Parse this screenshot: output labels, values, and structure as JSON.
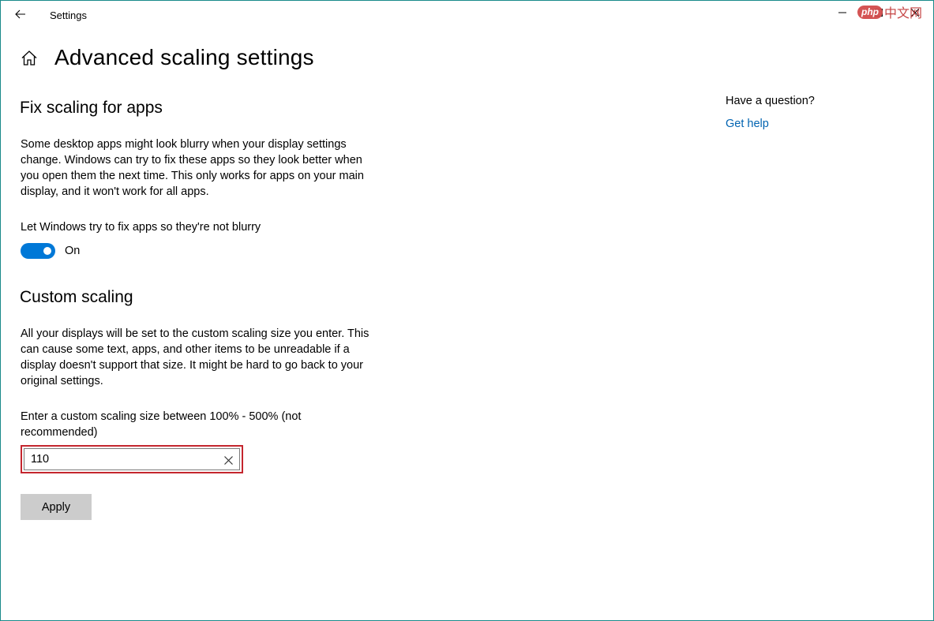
{
  "window": {
    "app_title": "Settings"
  },
  "watermark": {
    "badge": "php",
    "text": "中文网"
  },
  "header": {
    "title": "Advanced scaling settings"
  },
  "fix_scaling": {
    "title": "Fix scaling for apps",
    "description": "Some desktop apps might look blurry when your display settings change. Windows can try to fix these apps so they look better when you open them the next time. This only works for apps on your main display, and it won't work for all apps.",
    "toggle_label": "Let Windows try to fix apps so they're not blurry",
    "toggle_state": "On"
  },
  "custom_scaling": {
    "title": "Custom scaling",
    "description": "All your displays will be set to the custom scaling size you enter. This can cause some text, apps, and other items to be unreadable if a display doesn't support that size. It might be hard to go back to your original settings.",
    "input_label": "Enter a custom scaling size between 100% - 500% (not recommended)",
    "input_value": "110",
    "apply_label": "Apply"
  },
  "aside": {
    "question": "Have a question?",
    "help_link": "Get help"
  },
  "colors": {
    "accent": "#0078d7",
    "link": "#0063b1",
    "highlight_border": "#c4262e",
    "button_bg": "#cccccc"
  },
  "icons": {
    "back": "back-arrow-icon",
    "home": "home-icon",
    "minimize": "minimize-icon",
    "maximize": "maximize-icon",
    "close": "close-icon",
    "clear": "clear-icon"
  }
}
